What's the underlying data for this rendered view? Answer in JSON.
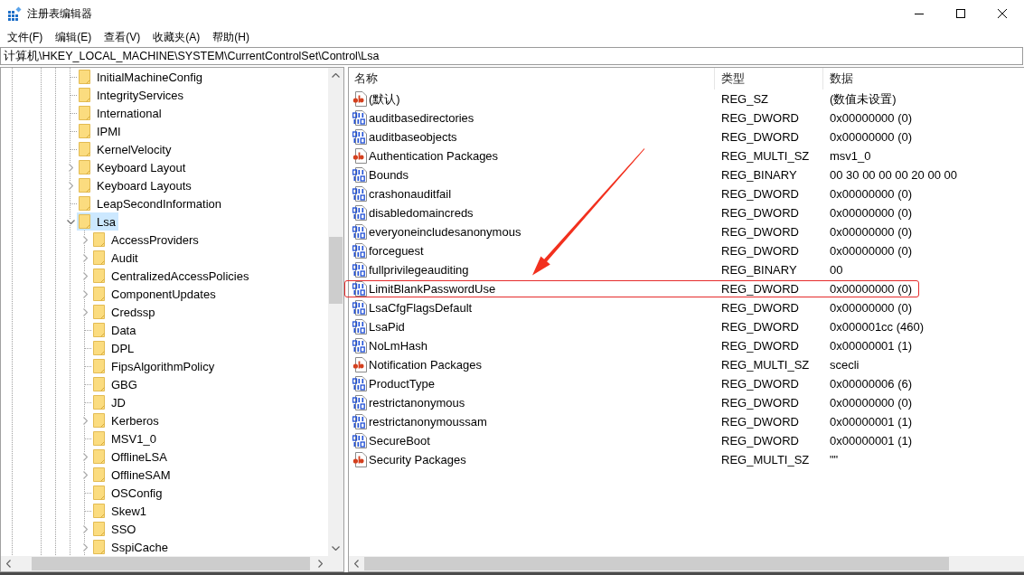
{
  "window": {
    "title": "注册表编辑器"
  },
  "menu": [
    "文件(F)",
    "编辑(E)",
    "查看(V)",
    "收藏夹(A)",
    "帮助(H)"
  ],
  "address_bar": {
    "value": "计算机\\HKEY_LOCAL_MACHINE\\SYSTEM\\CurrentControlSet\\Control\\Lsa"
  },
  "tree": [
    {
      "label": "InitialMachineConfig",
      "has_children": false,
      "expanded": false,
      "selected": false
    },
    {
      "label": "IntegrityServices",
      "has_children": false,
      "expanded": false,
      "selected": false
    },
    {
      "label": "International",
      "has_children": false,
      "expanded": false,
      "selected": false
    },
    {
      "label": "IPMI",
      "has_children": false,
      "expanded": false,
      "selected": false
    },
    {
      "label": "KernelVelocity",
      "has_children": false,
      "expanded": false,
      "selected": false
    },
    {
      "label": "Keyboard Layout",
      "has_children": true,
      "expanded": false,
      "selected": false
    },
    {
      "label": "Keyboard Layouts",
      "has_children": true,
      "expanded": false,
      "selected": false
    },
    {
      "label": "LeapSecondInformation",
      "has_children": false,
      "expanded": false,
      "selected": false
    },
    {
      "label": "Lsa",
      "has_children": true,
      "expanded": true,
      "selected": true,
      "children": [
        {
          "label": "AccessProviders",
          "has_children": true,
          "expanded": false,
          "selected": false
        },
        {
          "label": "Audit",
          "has_children": true,
          "expanded": false,
          "selected": false
        },
        {
          "label": "CentralizedAccessPolicies",
          "has_children": true,
          "expanded": false,
          "selected": false
        },
        {
          "label": "ComponentUpdates",
          "has_children": true,
          "expanded": false,
          "selected": false
        },
        {
          "label": "Credssp",
          "has_children": true,
          "expanded": false,
          "selected": false
        },
        {
          "label": "Data",
          "has_children": false,
          "expanded": false,
          "selected": false
        },
        {
          "label": "DPL",
          "has_children": false,
          "expanded": false,
          "selected": false
        },
        {
          "label": "FipsAlgorithmPolicy",
          "has_children": false,
          "expanded": false,
          "selected": false
        },
        {
          "label": "GBG",
          "has_children": false,
          "expanded": false,
          "selected": false
        },
        {
          "label": "JD",
          "has_children": false,
          "expanded": false,
          "selected": false
        },
        {
          "label": "Kerberos",
          "has_children": true,
          "expanded": false,
          "selected": false
        },
        {
          "label": "MSV1_0",
          "has_children": false,
          "expanded": false,
          "selected": false
        },
        {
          "label": "OfflineLSA",
          "has_children": true,
          "expanded": false,
          "selected": false
        },
        {
          "label": "OfflineSAM",
          "has_children": true,
          "expanded": false,
          "selected": false
        },
        {
          "label": "OSConfig",
          "has_children": false,
          "expanded": false,
          "selected": false
        },
        {
          "label": "Skew1",
          "has_children": false,
          "expanded": false,
          "selected": false
        },
        {
          "label": "SSO",
          "has_children": true,
          "expanded": false,
          "selected": false
        },
        {
          "label": "SspiCache",
          "has_children": true,
          "expanded": false,
          "selected": false
        }
      ]
    }
  ],
  "values": {
    "columns": [
      "名称",
      "类型",
      "数据"
    ],
    "rows": [
      {
        "kind": "string",
        "name": "(默认)",
        "type": "REG_SZ",
        "data": "(数值未设置)",
        "highlighted": false
      },
      {
        "kind": "binary",
        "name": "auditbasedirectories",
        "type": "REG_DWORD",
        "data": "0x00000000 (0)",
        "highlighted": false
      },
      {
        "kind": "binary",
        "name": "auditbaseobjects",
        "type": "REG_DWORD",
        "data": "0x00000000 (0)",
        "highlighted": false
      },
      {
        "kind": "string",
        "name": "Authentication Packages",
        "type": "REG_MULTI_SZ",
        "data": "msv1_0",
        "highlighted": false
      },
      {
        "kind": "binary",
        "name": "Bounds",
        "type": "REG_BINARY",
        "data": "00 30 00 00 00 20 00 00",
        "highlighted": false
      },
      {
        "kind": "binary",
        "name": "crashonauditfail",
        "type": "REG_DWORD",
        "data": "0x00000000 (0)",
        "highlighted": false
      },
      {
        "kind": "binary",
        "name": "disabledomaincreds",
        "type": "REG_DWORD",
        "data": "0x00000000 (0)",
        "highlighted": false
      },
      {
        "kind": "binary",
        "name": "everyoneincludesanonymous",
        "type": "REG_DWORD",
        "data": "0x00000000 (0)",
        "highlighted": false
      },
      {
        "kind": "binary",
        "name": "forceguest",
        "type": "REG_DWORD",
        "data": "0x00000000 (0)",
        "highlighted": false
      },
      {
        "kind": "binary",
        "name": "fullprivilegeauditing",
        "type": "REG_BINARY",
        "data": "00",
        "highlighted": false
      },
      {
        "kind": "binary",
        "name": "LimitBlankPasswordUse",
        "type": "REG_DWORD",
        "data": "0x00000000 (0)",
        "highlighted": true
      },
      {
        "kind": "binary",
        "name": "LsaCfgFlagsDefault",
        "type": "REG_DWORD",
        "data": "0x00000000 (0)",
        "highlighted": false
      },
      {
        "kind": "binary",
        "name": "LsaPid",
        "type": "REG_DWORD",
        "data": "0x000001cc (460)",
        "highlighted": false
      },
      {
        "kind": "binary",
        "name": "NoLmHash",
        "type": "REG_DWORD",
        "data": "0x00000001 (1)",
        "highlighted": false
      },
      {
        "kind": "string",
        "name": "Notification Packages",
        "type": "REG_MULTI_SZ",
        "data": "scecli",
        "highlighted": false
      },
      {
        "kind": "binary",
        "name": "ProductType",
        "type": "REG_DWORD",
        "data": "0x00000006 (6)",
        "highlighted": false
      },
      {
        "kind": "binary",
        "name": "restrictanonymous",
        "type": "REG_DWORD",
        "data": "0x00000000 (0)",
        "highlighted": false
      },
      {
        "kind": "binary",
        "name": "restrictanonymoussam",
        "type": "REG_DWORD",
        "data": "0x00000001 (1)",
        "highlighted": false
      },
      {
        "kind": "binary",
        "name": "SecureBoot",
        "type": "REG_DWORD",
        "data": "0x00000001 (1)",
        "highlighted": false
      },
      {
        "kind": "string",
        "name": "Security Packages",
        "type": "REG_MULTI_SZ",
        "data": "\"\"",
        "highlighted": false
      }
    ]
  }
}
